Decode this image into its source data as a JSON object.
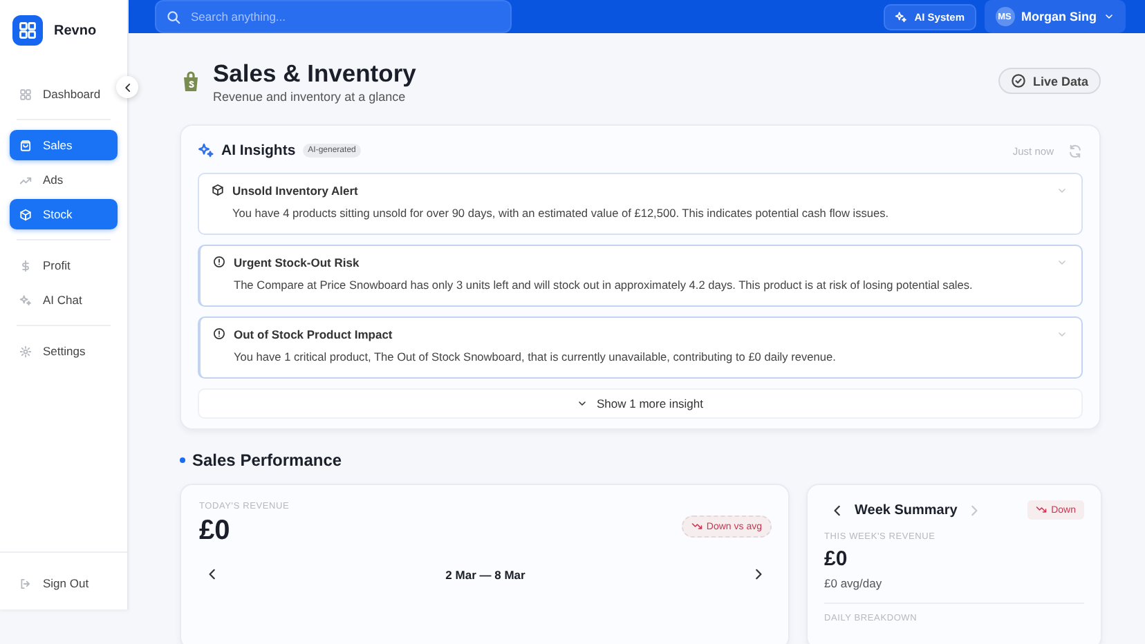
{
  "brand": {
    "name": "Revno"
  },
  "sidebar": {
    "groups": [
      {
        "items": [
          {
            "label": "Dashboard",
            "selected": false
          }
        ]
      },
      {
        "items": [
          {
            "label": "Sales",
            "selected": true
          },
          {
            "label": "Ads",
            "selected": false
          },
          {
            "label": "Stock",
            "selected": true
          }
        ]
      },
      {
        "items": [
          {
            "label": "Profit",
            "selected": false
          },
          {
            "label": "AI Chat",
            "selected": false
          }
        ]
      },
      {
        "items": [
          {
            "label": "Settings",
            "selected": false
          }
        ]
      }
    ],
    "sign_out": "Sign Out"
  },
  "topbar": {
    "search": {
      "placeholder": "Search anything..."
    },
    "ai_button": "AI System",
    "user": {
      "initials": "MS",
      "name": "Morgan Sing"
    }
  },
  "header": {
    "title": "Sales & Inventory",
    "subtitle": "Revenue and inventory at a glance",
    "live_button": "Live Data"
  },
  "insights": {
    "title": "AI Insights",
    "badge": "AI-generated",
    "updated": "Just now",
    "items": [
      {
        "kind": "inventory",
        "title": "Unsold Inventory Alert",
        "text": "You have 4 products sitting unsold for over 90 days, with an estimated value of £12,500. This indicates potential cash flow issues."
      },
      {
        "kind": "alert",
        "title": "Urgent Stock-Out Risk",
        "text": "The Compare at Price Snowboard has only 3 units left and will stock out in approximately 4.2 days. This product is at risk of losing potential sales."
      },
      {
        "kind": "alert",
        "title": "Out of Stock Product Impact",
        "text": "You have 1 critical product, The Out of Stock Snowboard, that is currently unavailable, contributing to £0 daily revenue."
      }
    ],
    "more": "Show 1 more insight"
  },
  "sales_performance": {
    "title": "Sales Performance",
    "today": {
      "label": "TODAY'S REVENUE",
      "value": "£0",
      "badge": "Down vs avg",
      "range": "2 Mar — 8 Mar"
    },
    "week": {
      "title": "Week Summary",
      "badge": "Down",
      "label": "THIS WEEK'S REVENUE",
      "value": "£0",
      "avg": "£0 avg/day",
      "breakdown_label": "DAILY BREAKDOWN"
    }
  }
}
